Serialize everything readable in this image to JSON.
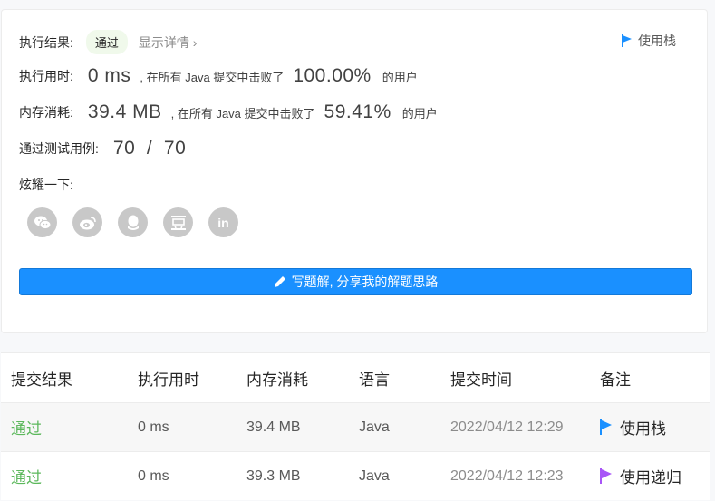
{
  "summary": {
    "result_label": "执行结果:",
    "result_status": "通过",
    "details_link": "显示详情 ›",
    "stack_link": "使用栈",
    "runtime": {
      "label": "执行用时:",
      "value": "0 ms",
      "beat_text": ", 在所有 Java 提交中击败了",
      "percent": "100.00%",
      "users_text": "的用户"
    },
    "memory": {
      "label": "内存消耗:",
      "value": "39.4 MB",
      "beat_text": ", 在所有 Java 提交中击败了",
      "percent": "59.41%",
      "users_text": "的用户"
    },
    "tests": {
      "label": "通过测试用例:",
      "value": "70  /  70"
    },
    "share_label": "炫耀一下:",
    "share_icons": [
      "wechat-icon",
      "weibo-icon",
      "qq-icon",
      "douban-icon",
      "linkedin-icon"
    ],
    "write_button": "写题解, 分享我的解题思路"
  },
  "table": {
    "headers": [
      "提交结果",
      "执行用时",
      "内存消耗",
      "语言",
      "提交时间",
      "备注"
    ],
    "rows": [
      {
        "result": "通过",
        "runtime": "0 ms",
        "memory": "39.4 MB",
        "language": "Java",
        "time": "2022/04/12 12:29",
        "note": "使用栈",
        "flag_color": "#1a90ff"
      },
      {
        "result": "通过",
        "runtime": "0 ms",
        "memory": "39.3 MB",
        "language": "Java",
        "time": "2022/04/12 12:23",
        "note": "使用递归",
        "flag_color": "#a855f7"
      }
    ]
  },
  "colors": {
    "accent": "#1a90ff",
    "pass": "#5cb85c",
    "pill_bg": "#f0f9eb"
  }
}
